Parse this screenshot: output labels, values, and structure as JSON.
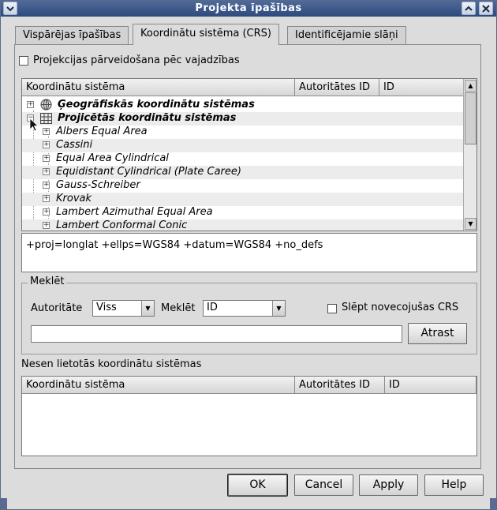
{
  "window": {
    "title": "Projekta īpašības"
  },
  "tabs": [
    {
      "label": "Vispārējas īpašības",
      "active": false
    },
    {
      "label": "Koordinātu sistēma (CRS)",
      "active": true
    },
    {
      "label": "Identificējamie slāņi",
      "active": false
    }
  ],
  "on_the_fly": {
    "label": "Projekcijas pārveidošana pēc vajadzības",
    "checked": false
  },
  "crs_tree": {
    "columns": [
      "Koordinātu sistēma",
      "Autoritātes ID",
      "ID"
    ],
    "rows": [
      {
        "label": "Ģeogrāfiskās koordinātu sistēmas",
        "level": 0,
        "icon": "globe-icon"
      },
      {
        "label": "Projicētās koordinātu sistēmas",
        "level": 0,
        "icon": "grid-icon"
      },
      {
        "label": "Albers Equal Area",
        "level": 1
      },
      {
        "label": "Cassini",
        "level": 1
      },
      {
        "label": "Equal Area Cylindrical",
        "level": 1
      },
      {
        "label": "Equidistant Cylindrical (Plate Caree)",
        "level": 1
      },
      {
        "label": "Gauss-Schreiber",
        "level": 1
      },
      {
        "label": "Krovak",
        "level": 1
      },
      {
        "label": "Lambert Azimuthal Equal Area",
        "level": 1
      },
      {
        "label": "Lambert Conformal Conic",
        "level": 1
      }
    ]
  },
  "proj_string": "+proj=longlat +ellps=WGS84 +datum=WGS84 +no_defs",
  "search": {
    "group_title": "Meklēt",
    "authority_label": "Autoritāte",
    "authority_value": "Viss",
    "search_label": "Meklēt",
    "search_value": "ID",
    "hide_deprecated_label": "Slēpt novecojušas CRS",
    "hide_deprecated_checked": false,
    "query_value": "",
    "find_button": "Atrast"
  },
  "recent": {
    "title": "Nesen lietotās koordinātu sistēmas",
    "columns": [
      "Koordinātu sistēma",
      "Autoritātes ID",
      "ID"
    ]
  },
  "buttons": {
    "ok": "OK",
    "cancel": "Cancel",
    "apply": "Apply",
    "help": "Help"
  }
}
